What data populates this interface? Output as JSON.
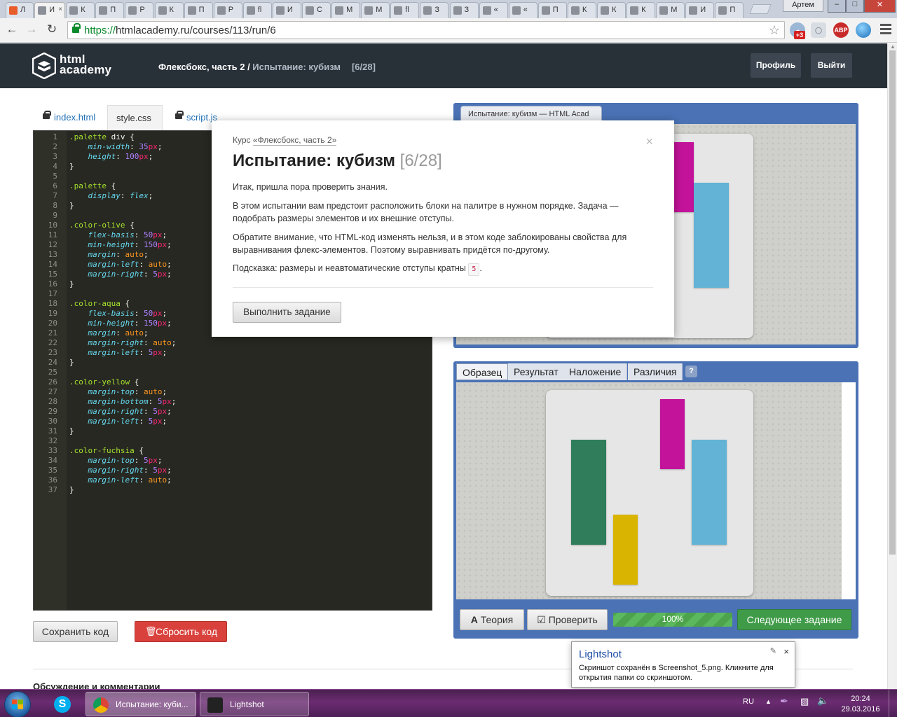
{
  "browser": {
    "tabs": [
      {
        "label": "Л",
        "active": false
      },
      {
        "label": "И",
        "active": true
      },
      {
        "label": "К",
        "active": false
      },
      {
        "label": "П",
        "active": false
      },
      {
        "label": "Р",
        "active": false
      },
      {
        "label": "К",
        "active": false
      },
      {
        "label": "П",
        "active": false
      },
      {
        "label": "Р",
        "active": false
      },
      {
        "label": "fl",
        "active": false
      },
      {
        "label": "И",
        "active": false
      },
      {
        "label": "С",
        "active": false
      },
      {
        "label": "М",
        "active": false
      },
      {
        "label": "М",
        "active": false
      },
      {
        "label": "fl",
        "active": false
      },
      {
        "label": "З",
        "active": false
      },
      {
        "label": "З",
        "active": false
      },
      {
        "label": "«",
        "active": false
      },
      {
        "label": "«",
        "active": false
      },
      {
        "label": "П",
        "active": false
      },
      {
        "label": "К",
        "active": false
      },
      {
        "label": "К",
        "active": false
      },
      {
        "label": "К",
        "active": false
      },
      {
        "label": "М",
        "active": false
      },
      {
        "label": "И",
        "active": false
      },
      {
        "label": "П",
        "active": false
      }
    ],
    "user_badge": "Артем",
    "url_scheme": "https://",
    "url_rest": "htmlacademy.ru/courses/113/run/6",
    "ext_badge": "+3",
    "adblock": "ABP"
  },
  "header": {
    "logo_line1": "html",
    "logo_line2": "academy",
    "breadcrumb_course": "Флексбокс, часть 2",
    "breadcrumb_sep": " / ",
    "breadcrumb_current": "Испытание: кубизм",
    "breadcrumb_step": "[6/28]",
    "profile_label": "Профиль",
    "logout_label": "Выйти"
  },
  "editor": {
    "tabs": [
      {
        "label": "index.html",
        "locked": true,
        "active": false
      },
      {
        "label": "style.css",
        "locked": false,
        "active": true
      },
      {
        "label": "script.js",
        "locked": true,
        "active": false
      }
    ],
    "lines": [
      {
        "n": "1",
        "t": [
          {
            "c": "sel",
            "v": ".palette"
          },
          {
            "c": "",
            "v": " div {"
          }
        ]
      },
      {
        "n": "2",
        "t": [
          {
            "c": "",
            "v": "    "
          },
          {
            "c": "prop",
            "v": "min-width"
          },
          {
            "c": "",
            "v": ": "
          },
          {
            "c": "num",
            "v": "35"
          },
          {
            "c": "unit",
            "v": "px"
          },
          {
            "c": "",
            "v": ";"
          }
        ]
      },
      {
        "n": "3",
        "t": [
          {
            "c": "",
            "v": "    "
          },
          {
            "c": "prop",
            "v": "height"
          },
          {
            "c": "",
            "v": ": "
          },
          {
            "c": "num",
            "v": "100"
          },
          {
            "c": "unit",
            "v": "px"
          },
          {
            "c": "",
            "v": ";"
          }
        ]
      },
      {
        "n": "4",
        "t": [
          {
            "c": "",
            "v": "}"
          }
        ]
      },
      {
        "n": "5",
        "t": []
      },
      {
        "n": "6",
        "t": [
          {
            "c": "sel",
            "v": ".palette"
          },
          {
            "c": "",
            "v": " {"
          }
        ]
      },
      {
        "n": "7",
        "t": [
          {
            "c": "",
            "v": "    "
          },
          {
            "c": "prop",
            "v": "display"
          },
          {
            "c": "",
            "v": ": "
          },
          {
            "c": "prop",
            "v": "flex"
          },
          {
            "c": "",
            "v": ";"
          }
        ]
      },
      {
        "n": "8",
        "t": [
          {
            "c": "",
            "v": "}"
          }
        ]
      },
      {
        "n": "9",
        "t": []
      },
      {
        "n": "10",
        "t": [
          {
            "c": "sel",
            "v": ".color-olive"
          },
          {
            "c": "",
            "v": " {"
          }
        ]
      },
      {
        "n": "11",
        "t": [
          {
            "c": "",
            "v": "    "
          },
          {
            "c": "prop",
            "v": "flex-basis"
          },
          {
            "c": "",
            "v": ": "
          },
          {
            "c": "num",
            "v": "50"
          },
          {
            "c": "unit",
            "v": "px"
          },
          {
            "c": "",
            "v": ";"
          }
        ]
      },
      {
        "n": "12",
        "t": [
          {
            "c": "",
            "v": "    "
          },
          {
            "c": "prop",
            "v": "min-height"
          },
          {
            "c": "",
            "v": ": "
          },
          {
            "c": "num",
            "v": "150"
          },
          {
            "c": "unit",
            "v": "px"
          },
          {
            "c": "",
            "v": ";"
          }
        ]
      },
      {
        "n": "13",
        "t": [
          {
            "c": "",
            "v": "    "
          },
          {
            "c": "prop",
            "v": "margin"
          },
          {
            "c": "",
            "v": ": "
          },
          {
            "c": "kw",
            "v": "auto"
          },
          {
            "c": "",
            "v": ";"
          }
        ]
      },
      {
        "n": "14",
        "t": [
          {
            "c": "",
            "v": "    "
          },
          {
            "c": "prop",
            "v": "margin-left"
          },
          {
            "c": "",
            "v": ": "
          },
          {
            "c": "kw",
            "v": "auto"
          },
          {
            "c": "",
            "v": ";"
          }
        ]
      },
      {
        "n": "15",
        "t": [
          {
            "c": "",
            "v": "    "
          },
          {
            "c": "prop",
            "v": "margin-right"
          },
          {
            "c": "",
            "v": ": "
          },
          {
            "c": "num",
            "v": "5"
          },
          {
            "c": "unit",
            "v": "px"
          },
          {
            "c": "",
            "v": ";"
          }
        ]
      },
      {
        "n": "16",
        "t": [
          {
            "c": "",
            "v": "}"
          }
        ]
      },
      {
        "n": "17",
        "t": []
      },
      {
        "n": "18",
        "t": [
          {
            "c": "sel",
            "v": ".color-aqua"
          },
          {
            "c": "",
            "v": " {"
          }
        ]
      },
      {
        "n": "19",
        "t": [
          {
            "c": "",
            "v": "    "
          },
          {
            "c": "prop",
            "v": "flex-basis"
          },
          {
            "c": "",
            "v": ": "
          },
          {
            "c": "num",
            "v": "50"
          },
          {
            "c": "unit",
            "v": "px"
          },
          {
            "c": "",
            "v": ";"
          }
        ]
      },
      {
        "n": "20",
        "t": [
          {
            "c": "",
            "v": "    "
          },
          {
            "c": "prop",
            "v": "min-height"
          },
          {
            "c": "",
            "v": ": "
          },
          {
            "c": "num",
            "v": "150"
          },
          {
            "c": "unit",
            "v": "px"
          },
          {
            "c": "",
            "v": ";"
          }
        ]
      },
      {
        "n": "21",
        "t": [
          {
            "c": "",
            "v": "    "
          },
          {
            "c": "prop",
            "v": "margin"
          },
          {
            "c": "",
            "v": ": "
          },
          {
            "c": "kw",
            "v": "auto"
          },
          {
            "c": "",
            "v": ";"
          }
        ]
      },
      {
        "n": "22",
        "t": [
          {
            "c": "",
            "v": "    "
          },
          {
            "c": "prop",
            "v": "margin-right"
          },
          {
            "c": "",
            "v": ": "
          },
          {
            "c": "kw",
            "v": "auto"
          },
          {
            "c": "",
            "v": ";"
          }
        ]
      },
      {
        "n": "23",
        "t": [
          {
            "c": "",
            "v": "    "
          },
          {
            "c": "prop",
            "v": "margin-left"
          },
          {
            "c": "",
            "v": ": "
          },
          {
            "c": "num",
            "v": "5"
          },
          {
            "c": "unit",
            "v": "px"
          },
          {
            "c": "",
            "v": ";"
          }
        ]
      },
      {
        "n": "24",
        "t": [
          {
            "c": "",
            "v": "}"
          }
        ]
      },
      {
        "n": "25",
        "t": []
      },
      {
        "n": "26",
        "t": [
          {
            "c": "sel",
            "v": ".color-yellow"
          },
          {
            "c": "",
            "v": " {"
          }
        ]
      },
      {
        "n": "27",
        "t": [
          {
            "c": "",
            "v": "    "
          },
          {
            "c": "prop",
            "v": "margin-top"
          },
          {
            "c": "",
            "v": ": "
          },
          {
            "c": "kw",
            "v": "auto"
          },
          {
            "c": "",
            "v": ";"
          }
        ]
      },
      {
        "n": "28",
        "t": [
          {
            "c": "",
            "v": "    "
          },
          {
            "c": "prop",
            "v": "margin-bottom"
          },
          {
            "c": "",
            "v": ": "
          },
          {
            "c": "num",
            "v": "5"
          },
          {
            "c": "unit",
            "v": "px"
          },
          {
            "c": "",
            "v": ";"
          }
        ]
      },
      {
        "n": "29",
        "t": [
          {
            "c": "",
            "v": "    "
          },
          {
            "c": "prop",
            "v": "margin-right"
          },
          {
            "c": "",
            "v": ": "
          },
          {
            "c": "num",
            "v": "5"
          },
          {
            "c": "unit",
            "v": "px"
          },
          {
            "c": "",
            "v": ";"
          }
        ]
      },
      {
        "n": "30",
        "t": [
          {
            "c": "",
            "v": "    "
          },
          {
            "c": "prop",
            "v": "margin-left"
          },
          {
            "c": "",
            "v": ": "
          },
          {
            "c": "num",
            "v": "5"
          },
          {
            "c": "unit",
            "v": "px"
          },
          {
            "c": "",
            "v": ";"
          }
        ]
      },
      {
        "n": "31",
        "t": [
          {
            "c": "",
            "v": "}"
          }
        ]
      },
      {
        "n": "32",
        "t": []
      },
      {
        "n": "33",
        "t": [
          {
            "c": "sel",
            "v": ".color-fuchsia"
          },
          {
            "c": "",
            "v": " {"
          }
        ]
      },
      {
        "n": "34",
        "t": [
          {
            "c": "",
            "v": "    "
          },
          {
            "c": "prop",
            "v": "margin-top"
          },
          {
            "c": "",
            "v": ": "
          },
          {
            "c": "num",
            "v": "5"
          },
          {
            "c": "unit",
            "v": "px"
          },
          {
            "c": "",
            "v": ";"
          }
        ]
      },
      {
        "n": "35",
        "t": [
          {
            "c": "",
            "v": "    "
          },
          {
            "c": "prop",
            "v": "margin-right"
          },
          {
            "c": "",
            "v": ": "
          },
          {
            "c": "num",
            "v": "5"
          },
          {
            "c": "unit",
            "v": "px"
          },
          {
            "c": "",
            "v": ";"
          }
        ]
      },
      {
        "n": "36",
        "t": [
          {
            "c": "",
            "v": "    "
          },
          {
            "c": "prop",
            "v": "margin-left"
          },
          {
            "c": "",
            "v": ": "
          },
          {
            "c": "kw",
            "v": "auto"
          },
          {
            "c": "",
            "v": ";"
          }
        ]
      },
      {
        "n": "37",
        "t": [
          {
            "c": "",
            "v": "}"
          }
        ]
      }
    ],
    "save_label": "Сохранить код",
    "reset_label": "Сбросить код"
  },
  "preview": {
    "window_tab": "Испытание: кубизм — HTML Acad",
    "view_tabs": [
      "Образец",
      "Результат",
      "Наложение",
      "Различия"
    ],
    "active_view": "Образец",
    "help_label": "?",
    "theory_label": "Теория",
    "check_label": "Проверить",
    "progress_label": "100%",
    "progress_percent": 100,
    "next_label": "Следующее задание",
    "colors": {
      "olive": "#2f7d5a",
      "yellow": "#d9b400",
      "fuchsia": "#c4139b",
      "aqua": "#62b3d5"
    }
  },
  "modal": {
    "course_prefix": "Курс",
    "course_link": "«Флексбокс, часть 2»",
    "title": "Испытание: кубизм",
    "title_step": "[6/28]",
    "p1": "Итак, пришла пора проверить знания.",
    "p2": "В этом испытании вам предстоит расположить блоки на палитре в нужном порядке. Задача — подобрать размеры элементов и их внешние отступы.",
    "p3": "Обратите внимание, что HTML-код изменять нельзя, и в этом коде заблокированы свойства для выравнивания флекс-элементов. Поэтому выравнивать придётся по-другому.",
    "p4": "Подсказка: размеры и неавтоматические отступы кратны",
    "p4_code": "5",
    "p4_end": ".",
    "start_label": "Выполнить задание",
    "close_label": "×"
  },
  "page": {
    "discussion_heading": "Обсуждение и комментарии"
  },
  "toast": {
    "title": "Lightshot",
    "body": "Скриншот сохранён в Screenshot_5.png. Кликните для открытия папки со скриншотом.",
    "close": "×"
  },
  "taskbar": {
    "tasks": [
      {
        "label": "Испытание: куби...",
        "active": true
      },
      {
        "label": "Lightshot",
        "active": false
      }
    ],
    "lang": "RU",
    "time": "20:24",
    "date": "29.03.2016"
  }
}
